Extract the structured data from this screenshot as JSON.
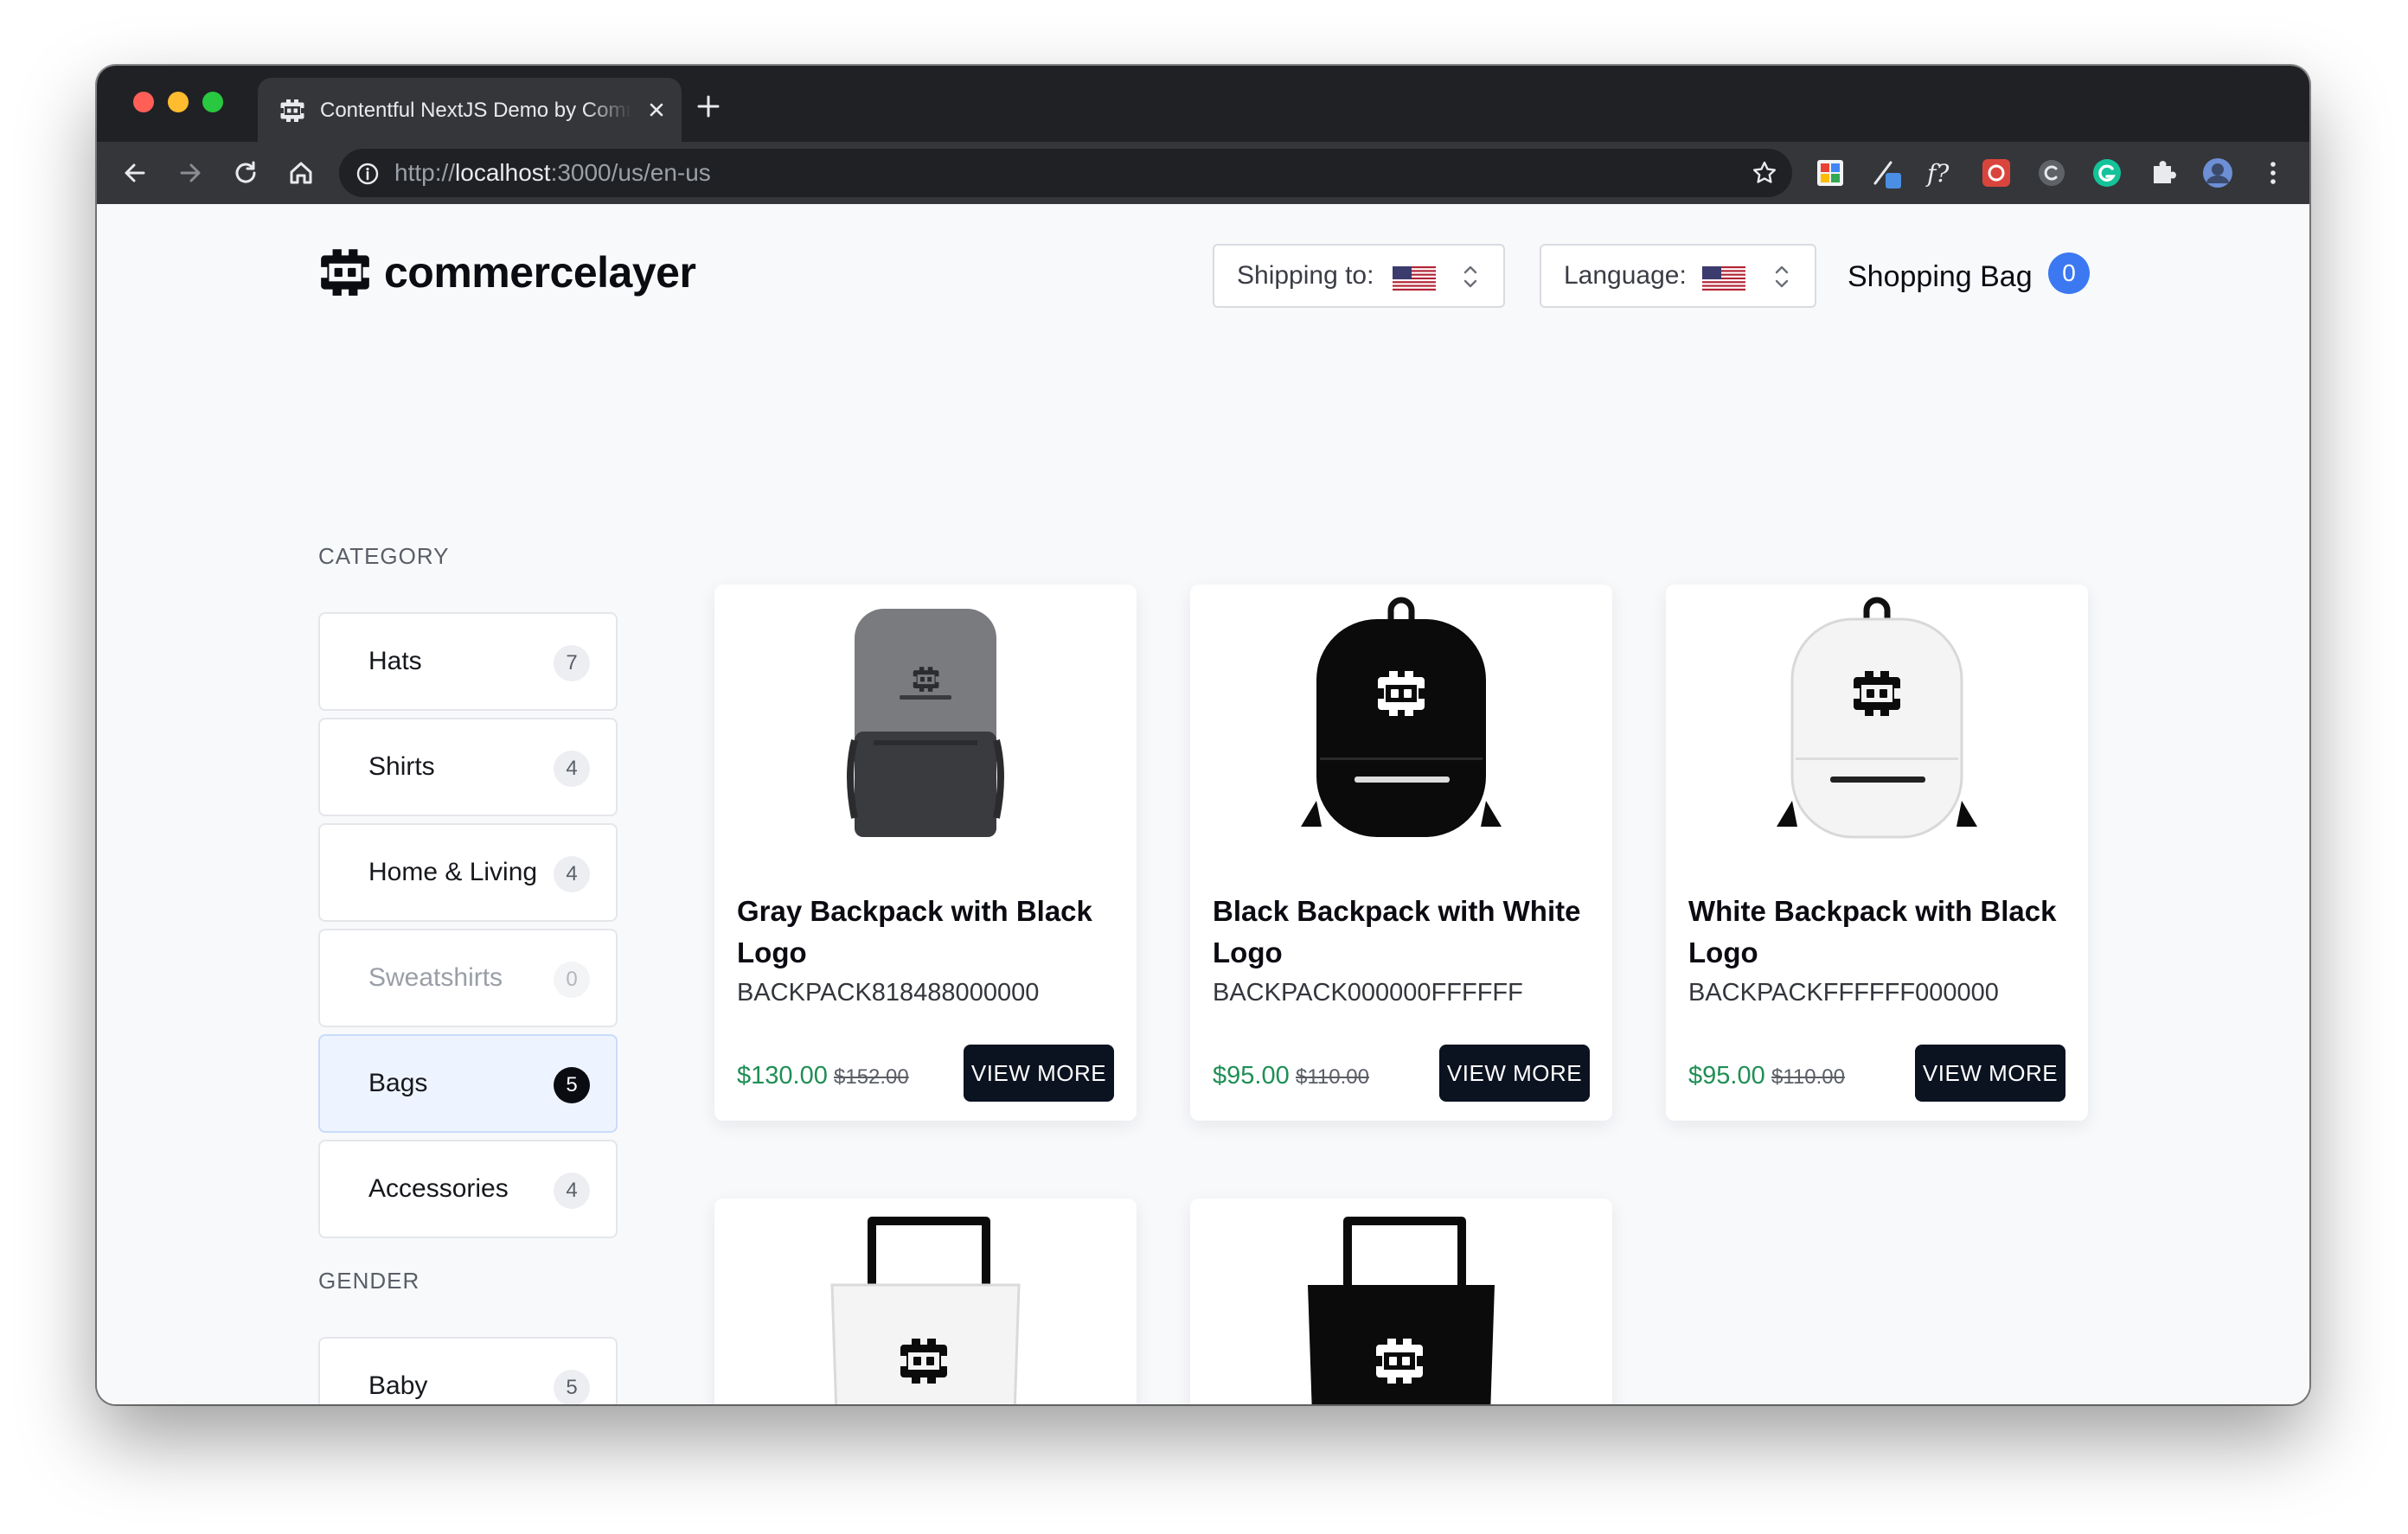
{
  "browser": {
    "tab_title": "Contentful NextJS Demo by Commerce Layer",
    "url_prefix": "http://",
    "url_host": "localhost",
    "url_path": ":3000/us/en-us"
  },
  "header": {
    "logo_text": "commercelayer",
    "shipping_label": "Shipping to:",
    "shipping_flag": "us-flag-icon",
    "language_label": "Language:",
    "language_flag": "us-flag-icon",
    "bag_label": "Shopping Bag",
    "bag_count": "0"
  },
  "sidebar": {
    "category_title": "CATEGORY",
    "categories": [
      {
        "label": "Hats",
        "count": "7",
        "state": "normal"
      },
      {
        "label": "Shirts",
        "count": "4",
        "state": "normal"
      },
      {
        "label": "Home & Living",
        "count": "4",
        "state": "normal"
      },
      {
        "label": "Sweatshirts",
        "count": "0",
        "state": "disabled"
      },
      {
        "label": "Bags",
        "count": "5",
        "state": "active"
      },
      {
        "label": "Accessories",
        "count": "4",
        "state": "normal"
      }
    ],
    "gender_title": "GENDER",
    "genders": [
      {
        "label": "Baby",
        "count": "5"
      }
    ]
  },
  "products": [
    {
      "name": "Gray Backpack with Black Logo",
      "sku": "BACKPACK818488000000",
      "price": "$130.00",
      "compare_price": "$152.00",
      "button": "VIEW MORE",
      "image": "gray-backpack"
    },
    {
      "name": "Black Backpack with White Logo",
      "sku": "BACKPACK000000FFFFFF",
      "price": "$95.00",
      "compare_price": "$110.00",
      "button": "VIEW MORE",
      "image": "black-backpack"
    },
    {
      "name": "White Backpack with Black Logo",
      "sku": "BACKPACKFFFFFF000000",
      "price": "$95.00",
      "compare_price": "$110.00",
      "button": "VIEW MORE",
      "image": "white-backpack"
    },
    {
      "image": "white-tote-bag"
    },
    {
      "image": "black-tote-bag"
    }
  ],
  "colors": {
    "accent_blue": "#3b78f2",
    "price_green": "#1f8f55",
    "button_dark": "#0b1220",
    "active_category_bg": "#eef4ff"
  }
}
